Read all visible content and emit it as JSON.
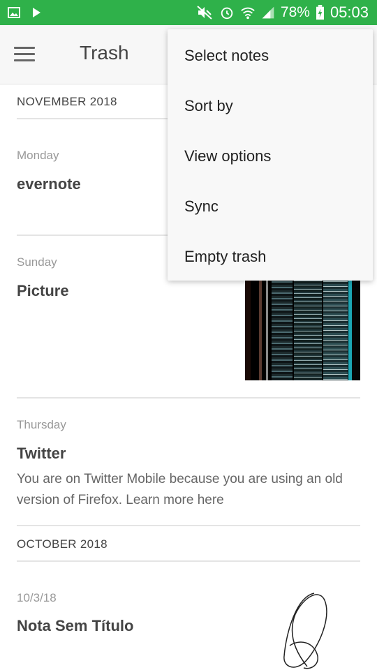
{
  "status_bar": {
    "battery": "78%",
    "time": "05:03",
    "icons": [
      "image-icon",
      "play-icon",
      "mute-icon",
      "alarm-icon",
      "wifi-icon",
      "signal-icon",
      "battery-charging-icon"
    ]
  },
  "toolbar": {
    "title": "Trash",
    "menu_icon": "hamburger-icon"
  },
  "sections": [
    {
      "header": "NOVEMBER 2018"
    },
    {
      "header": "OCTOBER 2018"
    }
  ],
  "notes": [
    {
      "date": "Monday",
      "title": "evernote",
      "snippet": ""
    },
    {
      "date": "Sunday",
      "title": "Picture",
      "snippet": "",
      "thumbnail": "glitch-image"
    },
    {
      "date": "Thursday",
      "title": "Twitter",
      "snippet": "You are on Twitter Mobile because you are using an old version of Firefox. Learn more here"
    },
    {
      "date": "10/3/18",
      "title": "Nota Sem Título",
      "snippet": "",
      "thumbnail": "scribble-drawing"
    }
  ],
  "menu": {
    "items": [
      "Select notes",
      "Sort by",
      "View options",
      "Sync",
      "Empty trash"
    ]
  },
  "colors": {
    "status_bar": "#2fb14a",
    "toolbar": "#f7f7f7"
  }
}
